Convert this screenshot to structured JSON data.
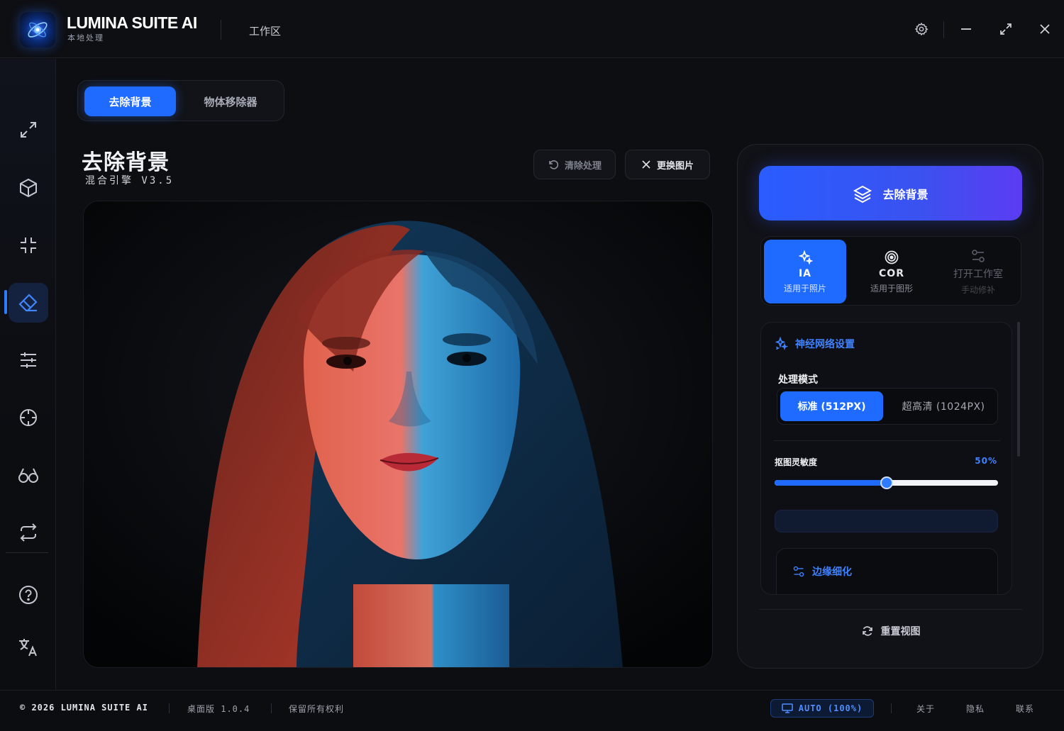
{
  "app": {
    "name": "LUMINA SUITE AI",
    "subtitle": "本地处理",
    "workspace": "工作区"
  },
  "tabs": {
    "remove_bg": "去除背景",
    "object_remover": "物体移除器"
  },
  "page": {
    "title": "去除背景",
    "subtitle": "混合引擎 V3.5",
    "clear_label": "清除处理",
    "replace_label": "更换图片"
  },
  "panel": {
    "primary_label": "去除背景",
    "engines": [
      {
        "name": "IA",
        "desc": "适用于照片"
      },
      {
        "name": "COR",
        "desc": "适用于图形"
      },
      {
        "name": "打开工作室",
        "desc": "手动修补"
      }
    ],
    "neural_title": "神经网络设置",
    "mode_label": "处理模式",
    "mode_standard": "标准 (512PX)",
    "mode_hd": "超高清 (1024PX)",
    "sensitivity_label": "抠图灵敏度",
    "sensitivity_value": "50%",
    "sensitivity": 0.5,
    "edge_title": "边缘细化",
    "reset_label": "重置视图"
  },
  "footer": {
    "copyright": "© 2026 LUMINA SUITE AI",
    "version": "桌面版 1.0.4",
    "rights": "保留所有权利",
    "auto": "AUTO (100%)",
    "about": "关于",
    "privacy": "隐私",
    "contact": "联系"
  },
  "colors": {
    "accent": "#1f6bff",
    "background": "#0d0e12",
    "panel": "#111217"
  },
  "icons": {
    "sidebar": [
      "expand-icon",
      "cube-icon",
      "collapse-icon",
      "eraser-icon",
      "sliders-icon",
      "crosshair-icon",
      "glasses-icon",
      "repeat-icon",
      "help-icon",
      "translate-icon"
    ],
    "window": [
      "gear-icon",
      "minimize-icon",
      "maximize-icon",
      "close-icon"
    ]
  }
}
